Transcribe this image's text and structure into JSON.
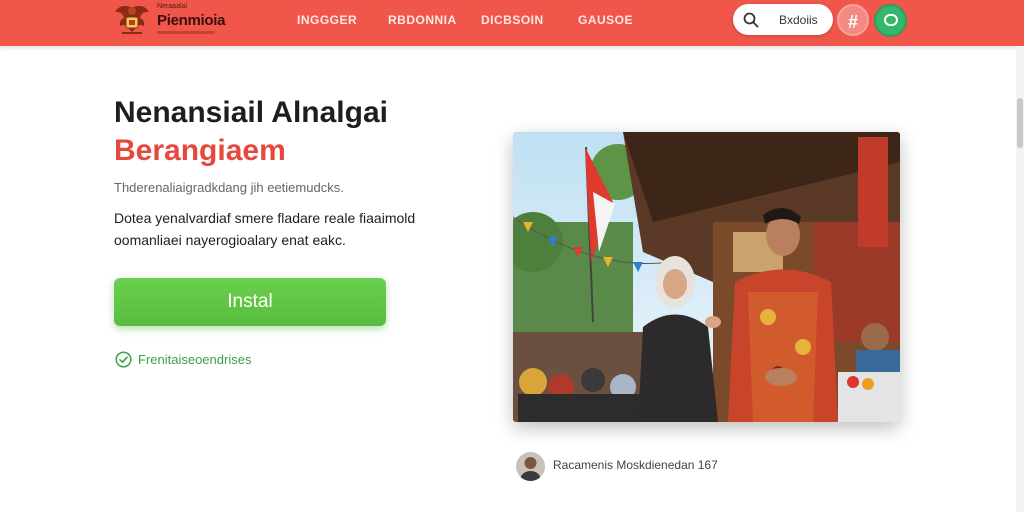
{
  "header": {
    "brand_small": "Neraaalal",
    "brand_name": "Pienmioia",
    "nav": [
      "INGGGER",
      "RBDONNIA",
      "DICBSOIN",
      "GAUSOE"
    ],
    "search_label": "Bxdoiis",
    "hash_icon": "hash-icon",
    "chat_icon": "chat-icon",
    "colors": {
      "bar": "#f0564a",
      "chat": "#34b76a"
    }
  },
  "hero": {
    "title": "Nenansiail Alnalgai",
    "subtitle": "Berangiaem",
    "tagline": "Thderenaliaigradkdang jih eetiemudcks.",
    "desc_line1": "Dotea yenalvardiaf smere fladare reale fiaaimold",
    "desc_line2": "oomanliaei nayerogioalary enat eakc.",
    "install_label": "Instal",
    "check_label": "Frenitaiseoendrises",
    "colors": {
      "accent": "#e5483c",
      "button": "#5fc445"
    }
  },
  "caption": {
    "text": "Racamenis Moskdienedan 167"
  }
}
